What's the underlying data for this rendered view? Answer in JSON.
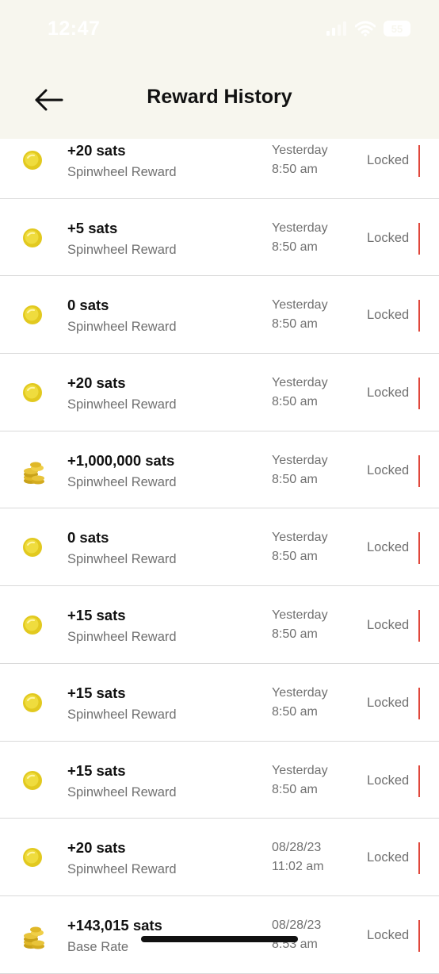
{
  "status_bar": {
    "time": "12:47",
    "battery": "55"
  },
  "header": {
    "title": "Reward History"
  },
  "rewards": [
    {
      "amount": "+20 sats",
      "description": "Spinwheel Reward",
      "date": "Yesterday",
      "time": "8:50 am",
      "status": "Locked",
      "icon": "coin-icon"
    },
    {
      "amount": "+5 sats",
      "description": "Spinwheel Reward",
      "date": "Yesterday",
      "time": "8:50 am",
      "status": "Locked",
      "icon": "coin-icon"
    },
    {
      "amount": "0 sats",
      "description": "Spinwheel Reward",
      "date": "Yesterday",
      "time": "8:50 am",
      "status": "Locked",
      "icon": "coin-icon"
    },
    {
      "amount": "+20 sats",
      "description": "Spinwheel Reward",
      "date": "Yesterday",
      "time": "8:50 am",
      "status": "Locked",
      "icon": "coin-icon"
    },
    {
      "amount": "+1,000,000 sats",
      "description": "Spinwheel Reward",
      "date": "Yesterday",
      "time": "8:50 am",
      "status": "Locked",
      "icon": "coin-stack-icon"
    },
    {
      "amount": "0 sats",
      "description": "Spinwheel Reward",
      "date": "Yesterday",
      "time": "8:50 am",
      "status": "Locked",
      "icon": "coin-icon"
    },
    {
      "amount": "+15 sats",
      "description": "Spinwheel Reward",
      "date": "Yesterday",
      "time": "8:50 am",
      "status": "Locked",
      "icon": "coin-icon"
    },
    {
      "amount": "+15 sats",
      "description": "Spinwheel Reward",
      "date": "Yesterday",
      "time": "8:50 am",
      "status": "Locked",
      "icon": "coin-icon"
    },
    {
      "amount": "+15 sats",
      "description": "Spinwheel Reward",
      "date": "Yesterday",
      "time": "8:50 am",
      "status": "Locked",
      "icon": "coin-icon"
    },
    {
      "amount": "+20 sats",
      "description": "Spinwheel Reward",
      "date": "08/28/23",
      "time": "11:02 am",
      "status": "Locked",
      "icon": "coin-icon"
    },
    {
      "amount": "+143,015 sats",
      "description": "Base Rate",
      "date": "08/28/23",
      "time": "8:53 am",
      "status": "Locked",
      "icon": "coin-stack-icon"
    }
  ],
  "colors": {
    "header_bg": "#f7f6ee",
    "locked_mark": "#e0473b",
    "coin": "#e2c91f"
  }
}
